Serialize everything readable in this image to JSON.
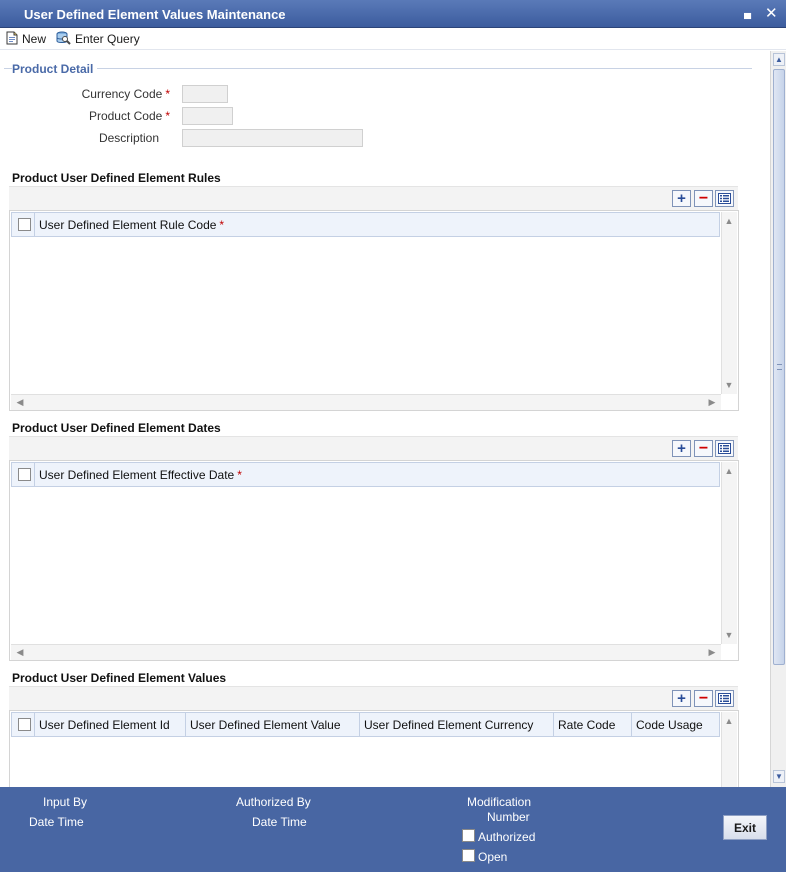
{
  "window": {
    "title": "User Defined Element Values Maintenance",
    "minimize_glyph": "▄",
    "close_glyph": "✕"
  },
  "toolbar": {
    "new_label": "New",
    "enter_query_label": "Enter Query"
  },
  "product_detail": {
    "legend": "Product Detail",
    "currency_code_label": "Currency Code",
    "product_code_label": "Product Code",
    "description_label": "Description",
    "required_marker": "*",
    "currency_code_value": "",
    "product_code_value": "",
    "description_value": ""
  },
  "rules_section": {
    "title": "Product User Defined Element Rules",
    "columns": [
      "User Defined Element Rule Code"
    ]
  },
  "dates_section": {
    "title": "Product User Defined Element Dates",
    "columns": [
      "User Defined Element Effective Date"
    ]
  },
  "values_section": {
    "title": "Product User Defined Element Values",
    "columns": [
      "User Defined Element Id",
      "User Defined Element Value",
      "User Defined Element Currency",
      "Rate Code",
      "Code Usage"
    ]
  },
  "grid_buttons": {
    "add": "+",
    "delete": "−"
  },
  "footer": {
    "input_by_label": "Input By",
    "date_time_label": "Date Time",
    "authorized_by_label": "Authorized By",
    "date_time_label_2": "Date Time",
    "modification_label": "Modification",
    "number_label": "Number",
    "authorized_label": "Authorized",
    "open_label": "Open",
    "exit_label": "Exit"
  },
  "colors": {
    "titlebar": "#3c5c9e",
    "footer": "#4866a3",
    "legend": "#4a6aa8",
    "required": "#c00000"
  }
}
